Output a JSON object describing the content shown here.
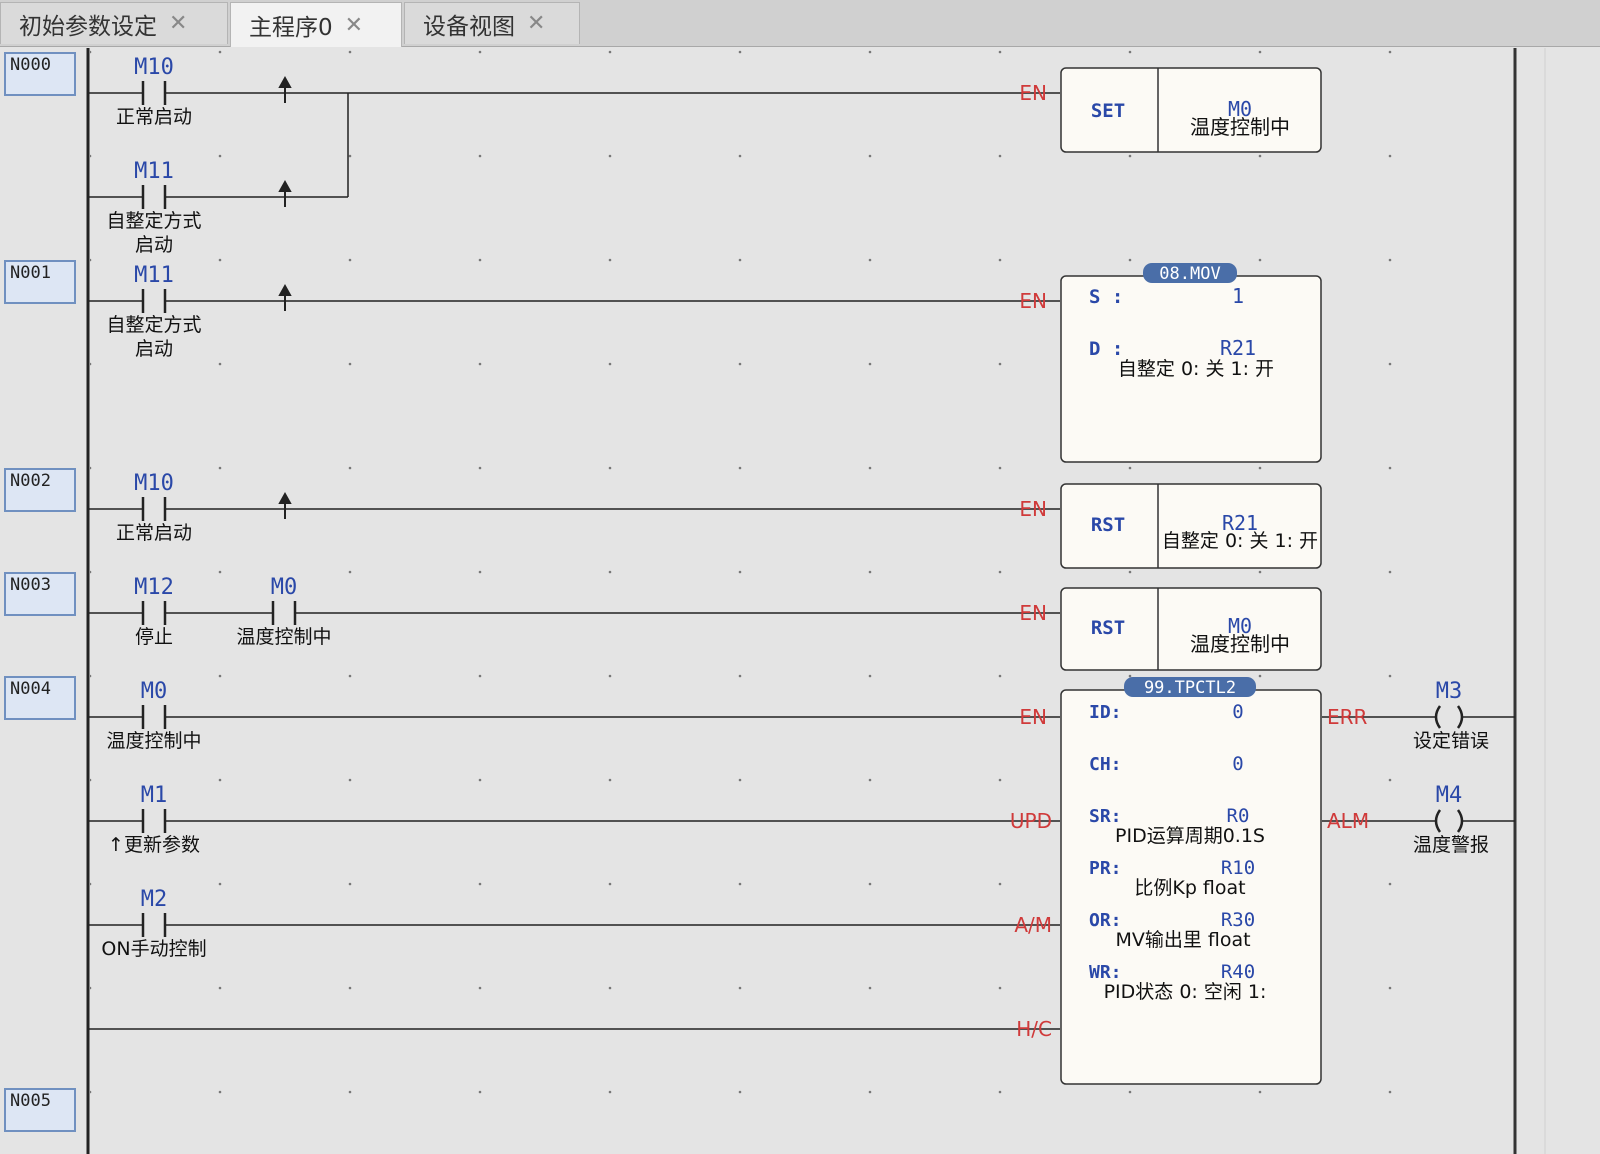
{
  "tabs": [
    {
      "label": "初始参数设定",
      "active": false
    },
    {
      "label": "主程序0",
      "active": true
    },
    {
      "label": "设备视图",
      "active": false
    }
  ],
  "close_glyph": "✕",
  "rungs": [
    "N000",
    "N001",
    "N002",
    "N003",
    "N004",
    "N005"
  ],
  "colors": {
    "device": "#2a48a8",
    "pin": "#d03a3a",
    "box_title": "#4a6ea8",
    "comment": "#111111"
  },
  "contacts": [
    {
      "device": "M10",
      "comment": "正常启动",
      "comment2": ""
    },
    {
      "device": "M11",
      "comment": "自整定方式",
      "comment2": "启动"
    },
    {
      "device": "M11",
      "comment": "自整定方式",
      "comment2": "启动"
    },
    {
      "device": "M10",
      "comment": "正常启动",
      "comment2": ""
    },
    {
      "device": "M12",
      "comment": "停止",
      "comment2": ""
    },
    {
      "device": "M0",
      "comment": "温度控制中",
      "comment2": ""
    },
    {
      "device": "M0",
      "comment": "温度控制中",
      "comment2": ""
    },
    {
      "device": "M1",
      "comment": "↑更新参数",
      "comment2": ""
    },
    {
      "device": "M2",
      "comment": "ON手动控制",
      "comment2": ""
    }
  ],
  "pins": {
    "en": "EN",
    "upd": "UPD",
    "am": "A/M",
    "hc": "H/C",
    "err": "ERR",
    "alm": "ALM"
  },
  "set_box": {
    "op": "SET",
    "device": "M0",
    "comment": "温度控制中"
  },
  "mov_box": {
    "title": "08.MOV",
    "s_label": "S :",
    "s_value": "1",
    "d_label": "D :",
    "d_value": "R21",
    "d_comment": "自整定 0: 关  1: 开"
  },
  "rst_box1": {
    "op": "RST",
    "device": "R21",
    "comment": "自整定 0: 关  1: 开"
  },
  "rst_box2": {
    "op": "RST",
    "device": "M0",
    "comment": "温度控制中"
  },
  "tpctl_box": {
    "title": "99.TPCTL2",
    "params": [
      {
        "label": "ID:",
        "value": "0",
        "comment": ""
      },
      {
        "label": "CH:",
        "value": "0",
        "comment": ""
      },
      {
        "label": "SR:",
        "value": "R0",
        "comment": "PID运算周期0.1S"
      },
      {
        "label": "PR:",
        "value": "R10",
        "comment": "比例Kp float"
      },
      {
        "label": "OR:",
        "value": "R30",
        "comment": "MV输出里 float"
      },
      {
        "label": "WR:",
        "value": "R40",
        "comment": "PID状态  0: 空闲   1:"
      }
    ]
  },
  "coils": [
    {
      "device": "M3",
      "comment": "设定错误"
    },
    {
      "device": "M4",
      "comment": "温度警报"
    }
  ]
}
